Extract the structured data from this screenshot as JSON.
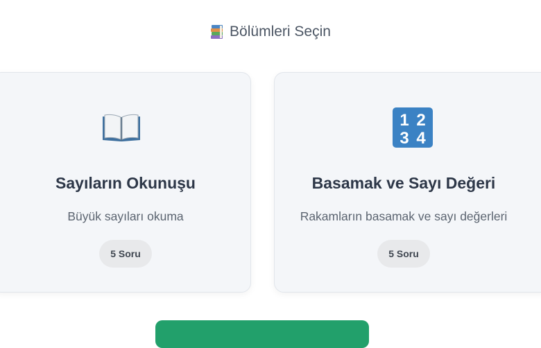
{
  "header": {
    "icon": "books-icon",
    "title": "Bölümleri Seçin"
  },
  "sections": [
    {
      "icon": "open-book-icon",
      "title": "Sayıların Okunuşu",
      "description": "Büyük sayıları okuma",
      "badge": "5 Soru"
    },
    {
      "icon": "numbers-1234-icon",
      "icon_digits": [
        "1",
        "2",
        "3",
        "4"
      ],
      "title": "Basamak ve Sayı Değeri",
      "description": "Rakamların basamak ve sayı değerleri",
      "badge": "5 Soru"
    }
  ],
  "colors": {
    "accent_green": "#22a06b",
    "numbers_icon_blue": "#3b82c4",
    "card_background": "#f4f6f9",
    "badge_background": "#e8e9eb"
  }
}
